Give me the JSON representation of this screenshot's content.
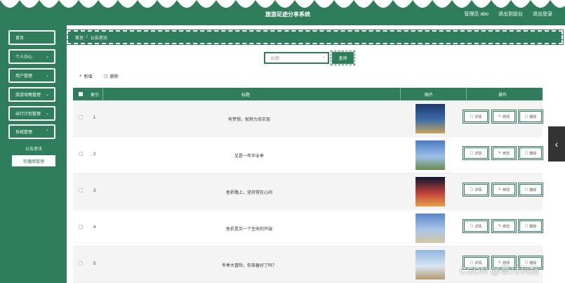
{
  "header": {
    "app_title": "旅游足迹分享系统",
    "nav": [
      "管理员 abo",
      "退出到前台",
      "退出登录"
    ]
  },
  "sidebar": {
    "items": [
      {
        "label": "首页"
      },
      {
        "label": "个人中心"
      },
      {
        "label": "用户管理"
      },
      {
        "label": "旅游攻略管理"
      },
      {
        "label": "出行计划管理"
      },
      {
        "label": "系统管理"
      }
    ],
    "sub_items": [
      {
        "label": "公告资讯"
      },
      {
        "label": "轮播图管理"
      }
    ]
  },
  "breadcrumb": {
    "home": "首页",
    "sep": "/",
    "current": "公告资讯"
  },
  "search": {
    "placeholder": "标题",
    "button": "查询"
  },
  "toolbar": {
    "add": "新增",
    "delete": "删除"
  },
  "table": {
    "headers": {
      "index": "索引",
      "title": "标题",
      "image": "图片",
      "actions": "操作"
    },
    "actions": {
      "detail": "详情",
      "edit": "修改",
      "delete": "删除"
    },
    "rows": [
      {
        "index": "1",
        "title": "有梦想，就努力去实现"
      },
      {
        "index": "2",
        "title": "又是一年毕业季"
      },
      {
        "index": "3",
        "title": "挫折路上，坚持常在心间"
      },
      {
        "index": "4",
        "title": "挫折是另一个生命的开端"
      },
      {
        "index": "5",
        "title": "冬季大冒险，你准备好了吗？"
      }
    ]
  },
  "watermark": "CSDN @草月科技",
  "colors": {
    "primary": "#2e7d5b",
    "white": "#ffffff"
  }
}
